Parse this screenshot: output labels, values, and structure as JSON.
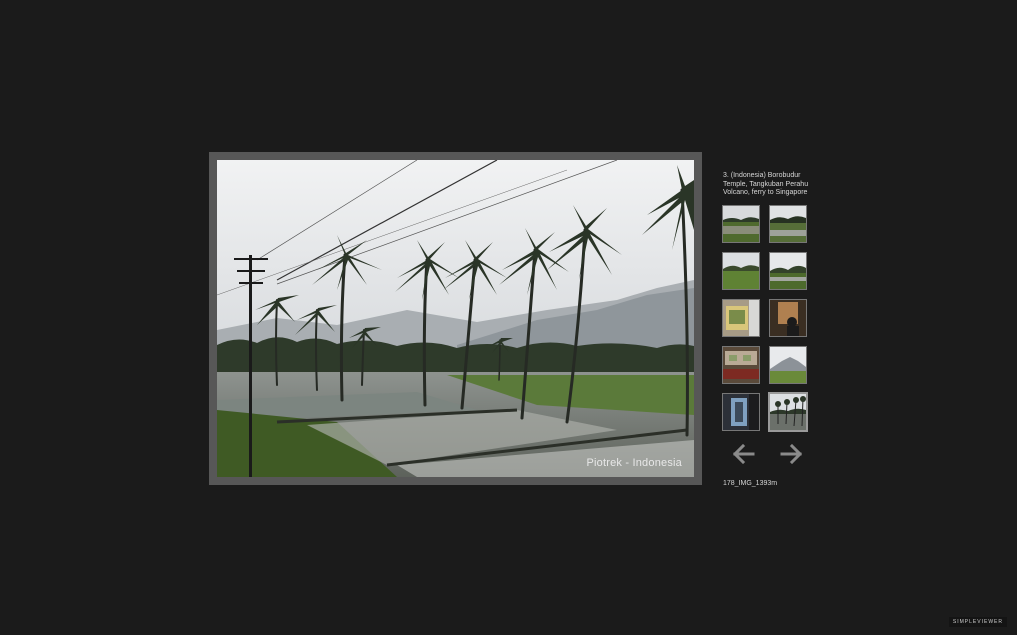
{
  "gallery": {
    "title": "3. (Indonesia) Borobudur Temple, Tangkuban Perahu Volcano, ferry to Singapore"
  },
  "main_image": {
    "watermark": "Piotrek - Indonesia",
    "caption": "178_IMG_1393m"
  },
  "thumbnails": [
    {
      "scene": "rice-field"
    },
    {
      "scene": "rice-field-palms"
    },
    {
      "scene": "green-field"
    },
    {
      "scene": "field-hills"
    },
    {
      "scene": "train-window"
    },
    {
      "scene": "train-interior-person"
    },
    {
      "scene": "train-interior"
    },
    {
      "scene": "volcano-landscape"
    },
    {
      "scene": "window-view"
    },
    {
      "scene": "palms-rice-field"
    }
  ],
  "selected_thumbnail": 9,
  "navigation": {
    "prev_icon": "arrow-left-icon",
    "next_icon": "arrow-right-icon"
  },
  "brand": "SIMPLEVIEWER",
  "colors": {
    "background": "#1b1b1b",
    "frame": "#575757",
    "text": "#d6d6d6",
    "arrow": "#8a8a8a"
  }
}
